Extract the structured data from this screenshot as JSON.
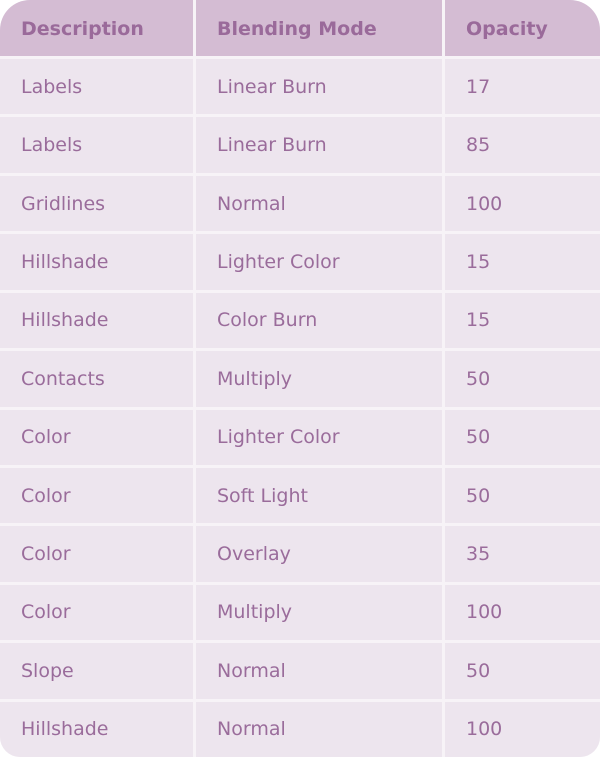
{
  "table": {
    "headers": [
      "Description",
      "Blending Mode",
      "Opacity"
    ],
    "rows": [
      [
        "Labels",
        "Linear Burn",
        "17"
      ],
      [
        "Labels",
        "Linear Burn",
        "85"
      ],
      [
        "Gridlines",
        "Normal",
        "100"
      ],
      [
        "Hillshade",
        "Lighter Color",
        "15"
      ],
      [
        "Hillshade",
        "Color Burn",
        "15"
      ],
      [
        "Contacts",
        "Multiply",
        "50"
      ],
      [
        "Color",
        "Lighter Color",
        "50"
      ],
      [
        "Color",
        "Soft Light",
        "50"
      ],
      [
        "Color",
        "Overlay",
        "35"
      ],
      [
        "Color",
        "Multiply",
        "100"
      ],
      [
        "Slope",
        "Normal",
        "50"
      ],
      [
        "Hillshade",
        "Normal",
        "100"
      ]
    ]
  },
  "colors": {
    "header_bg": "#d4bcd3",
    "row_bg": "#ede5ee",
    "text": "#9a6c9b"
  }
}
